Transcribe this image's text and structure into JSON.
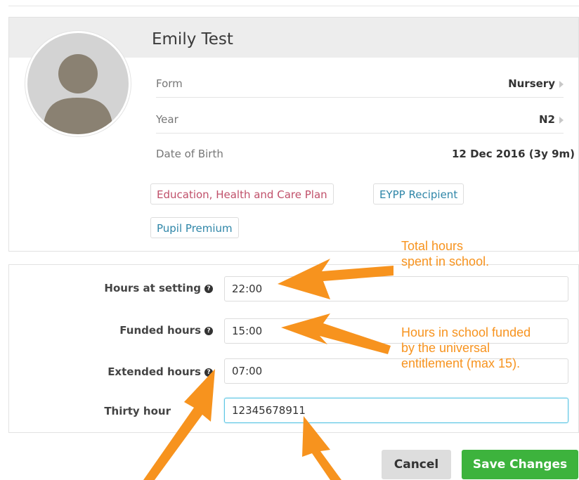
{
  "student": {
    "name": "Emily Test",
    "fields": [
      {
        "label": "Form",
        "value": "Nursery"
      },
      {
        "label": "Year",
        "value": "N2"
      },
      {
        "label": "Date of Birth",
        "value": "12 Dec 2016 (3y 9m)"
      }
    ],
    "tags": [
      "Education, Health and Care Plan",
      "EYPP Recipient",
      "Pupil Premium"
    ]
  },
  "form": {
    "help_icon": "question-circle-icon",
    "hours_at_setting": {
      "label": "Hours at setting",
      "value": "22:00"
    },
    "funded_hours": {
      "label": "Funded hours",
      "value": "15:00"
    },
    "extended_hours": {
      "label": "Extended hours",
      "value": "07:00"
    },
    "thirty_hours": {
      "label": "Thirty hour",
      "value": "12345678911"
    }
  },
  "buttons": {
    "cancel": "Cancel",
    "save": "Save Changes"
  },
  "annotations": {
    "total_hours": [
      "Total hours",
      "spent in school."
    ],
    "funded_hours": [
      "Hours in school funded",
      "by the universal",
      "entitlement (max 15)."
    ]
  },
  "colors": {
    "accent_orange": "#f7931e",
    "save_green": "#3db33d",
    "focus_blue": "#5cc6e4",
    "ehcp_tag": "#c0506a",
    "info_tag": "#2f86a8"
  }
}
